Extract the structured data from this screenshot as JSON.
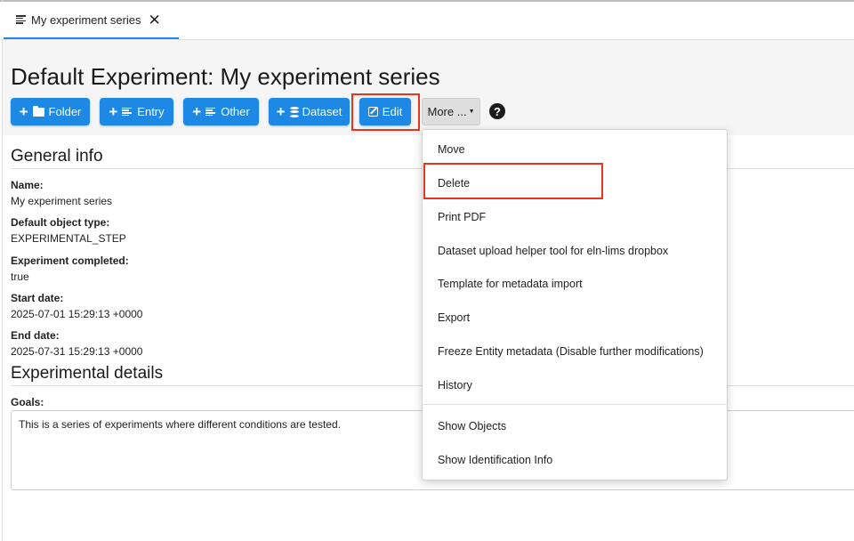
{
  "tab": {
    "label": "My experiment series",
    "icon": "list-icon",
    "close_icon": "close-icon"
  },
  "page": {
    "title": "Default Experiment: My experiment series"
  },
  "toolbar": {
    "folder": "Folder",
    "entry": "Entry",
    "other": "Other",
    "dataset": "Dataset",
    "edit": "Edit",
    "more": "More ...",
    "help": "?"
  },
  "general_info": {
    "heading": "General info",
    "fields": [
      {
        "label": "Name:",
        "value": "My experiment series"
      },
      {
        "label": "Default object type:",
        "value": "EXPERIMENTAL_STEP"
      },
      {
        "label": "Experiment completed:",
        "value": "true"
      },
      {
        "label": "Start date:",
        "value": "2025-07-01 15:29:13 +0000"
      },
      {
        "label": "End date:",
        "value": "2025-07-31 15:29:13 +0000"
      }
    ]
  },
  "experimental_details": {
    "heading": "Experimental details",
    "goals_label": "Goals:",
    "goals_value": "This is a series of experiments where different conditions are tested."
  },
  "more_menu": {
    "items": [
      "Move",
      "Delete",
      "Print PDF",
      "Dataset upload helper tool for eln-lims dropbox",
      "Template for metadata import",
      "Export",
      "Freeze Entity metadata (Disable further modifications)",
      "History",
      "Show Objects",
      "Show Identification Info"
    ]
  },
  "colors": {
    "primary": "#1e88e5",
    "highlight": "#e8341c",
    "header_bg": "#f5f5f5"
  }
}
